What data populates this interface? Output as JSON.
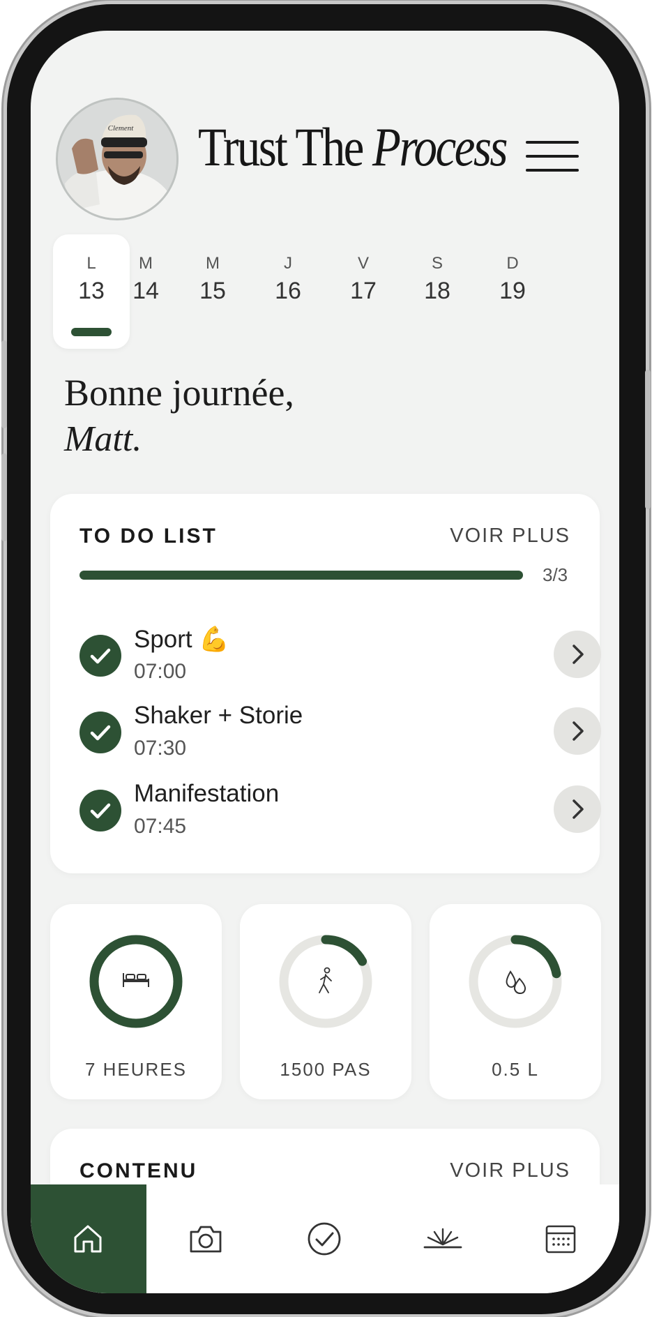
{
  "header": {
    "title_regular": "Trust The",
    "title_italic": "Process",
    "avatar_icon": "user-avatar-photo",
    "menu_icon": "hamburger-menu-icon"
  },
  "week": [
    {
      "letter": "L",
      "day": "13",
      "selected": true
    },
    {
      "letter": "M",
      "day": "14",
      "selected": false
    },
    {
      "letter": "M",
      "day": "15",
      "selected": false
    },
    {
      "letter": "J",
      "day": "16",
      "selected": false
    },
    {
      "letter": "V",
      "day": "17",
      "selected": false
    },
    {
      "letter": "S",
      "day": "18",
      "selected": false
    },
    {
      "letter": "D",
      "day": "19",
      "selected": false
    }
  ],
  "greeting": {
    "line1": "Bonne journée,",
    "name": "Matt."
  },
  "todo": {
    "title": "TO DO LIST",
    "see_more": "VOIR PLUS",
    "progress_label": "3/3",
    "progress_fraction": 1.0,
    "items": [
      {
        "name": "Sport 💪",
        "time": "07:00",
        "done": true
      },
      {
        "name": "Shaker + Storie",
        "time": "07:30",
        "done": true
      },
      {
        "name": "Manifestation",
        "time": "07:45",
        "done": true
      }
    ]
  },
  "stats": [
    {
      "icon": "bed-icon",
      "label": "7 HEURES",
      "progress": 1.0
    },
    {
      "icon": "walking-person-icon",
      "label": "1500 PAS",
      "progress": 0.17
    },
    {
      "icon": "water-drops-icon",
      "label": "0.5 L",
      "progress": 0.22
    }
  ],
  "content": {
    "title": "CONTENU",
    "see_more": "VOIR PLUS"
  },
  "tabbar": [
    {
      "icon": "home-icon",
      "active": true
    },
    {
      "icon": "camera-icon",
      "active": false
    },
    {
      "icon": "check-circle-icon",
      "active": false
    },
    {
      "icon": "sunrise-icon",
      "active": false
    },
    {
      "icon": "calendar-icon",
      "active": false
    }
  ],
  "colors": {
    "accent": "#2d5134",
    "background": "#f2f3f2",
    "card": "#ffffff",
    "ring_track": "#e6e6e2"
  }
}
